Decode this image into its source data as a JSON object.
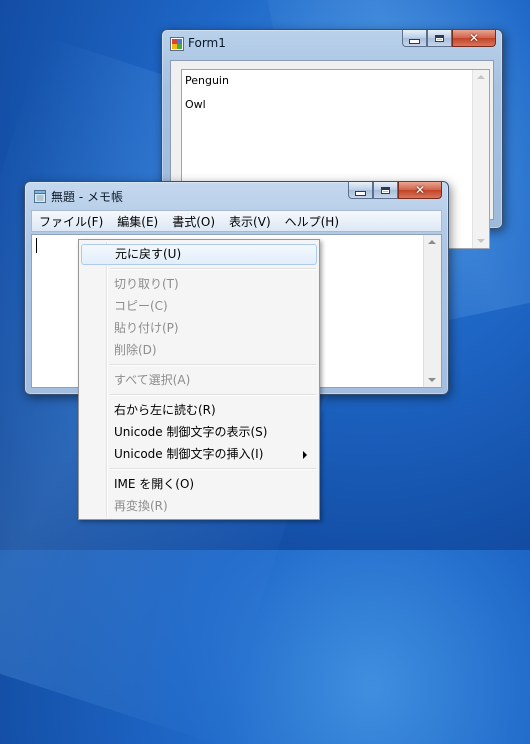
{
  "desktop": {
    "background": "#1c5fbf"
  },
  "form1": {
    "title": "Form1",
    "list_items": [
      "Penguin",
      "Owl"
    ],
    "icon": "app-icon"
  },
  "notepad": {
    "title": "無題 - メモ帳",
    "icon": "notepad-icon",
    "menu": [
      "ファイル(F)",
      "編集(E)",
      "書式(O)",
      "表示(V)",
      "ヘルプ(H)"
    ]
  },
  "context_menu": {
    "items": [
      {
        "label": "元に戻す(U)",
        "enabled": true,
        "highlighted": true
      },
      {
        "label": "切り取り(T)",
        "enabled": false
      },
      {
        "label": "コピー(C)",
        "enabled": false
      },
      {
        "label": "貼り付け(P)",
        "enabled": false
      },
      {
        "label": "削除(D)",
        "enabled": false
      },
      {
        "label": "すべて選択(A)",
        "enabled": false
      },
      {
        "label": "右から左に読む(R)",
        "enabled": true
      },
      {
        "label": "Unicode 制御文字の表示(S)",
        "enabled": true
      },
      {
        "label": "Unicode 制御文字の挿入(I)",
        "enabled": true,
        "submenu": true
      },
      {
        "label": "IME を開く(O)",
        "enabled": true
      },
      {
        "label": "再変換(R)",
        "enabled": false
      }
    ]
  },
  "colors": {
    "close_button": "#c44a2e",
    "menu_highlight": "#aecbee",
    "disabled_text": "#8d8d8d"
  }
}
